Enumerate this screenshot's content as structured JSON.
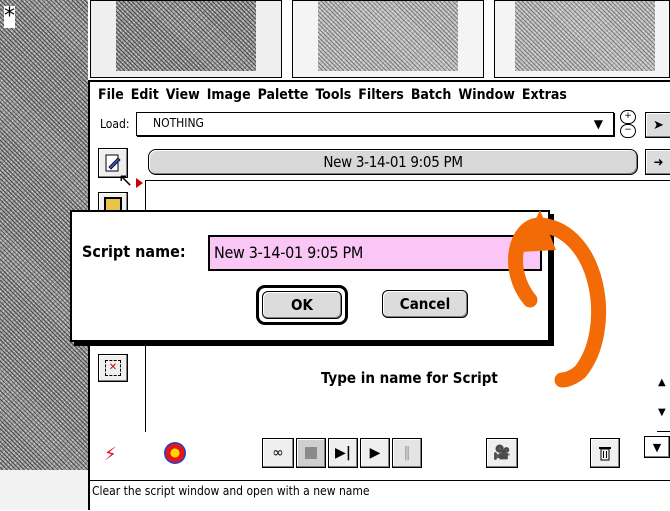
{
  "asterisk": "*",
  "menubar": {
    "items": [
      "File",
      "Edit",
      "View",
      "Image",
      "Palette",
      "Tools",
      "Filters",
      "Batch",
      "Window",
      "Extras"
    ]
  },
  "load_row": {
    "label": "Load:",
    "value": "NOTHING"
  },
  "script_title": "New 3-14-01 9:05 PM",
  "dialog": {
    "label": "Script name:",
    "value": "New 3-14-01 9:05 PM",
    "ok": "OK",
    "cancel": "Cancel"
  },
  "annotation": "Type in name for Script",
  "status_text": "Clear the script window and open with a new name",
  "colors": {
    "dialog_input": "#f9c6f6",
    "arrow": "#f26b06",
    "toolbar_bg": "#d4d4d4"
  },
  "icons": [
    "new-script-icon",
    "record-icon",
    "target-icon",
    "glasses-icon",
    "stop-icon",
    "step-icon",
    "play-icon",
    "pause-icon",
    "film-icon",
    "trash-icon",
    "menu-triangle-icon"
  ]
}
